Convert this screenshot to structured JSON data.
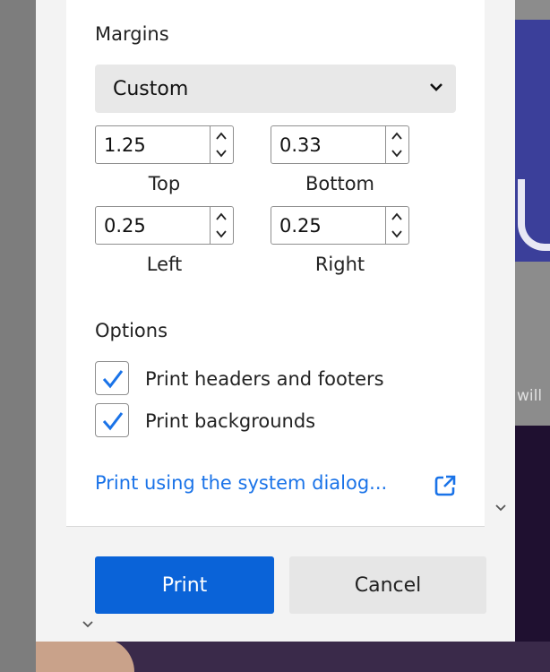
{
  "margins": {
    "heading": "Margins",
    "select_value": "Custom",
    "fields": {
      "top": {
        "value": "1.25",
        "label": "Top"
      },
      "bottom": {
        "value": "0.33",
        "label": "Bottom"
      },
      "left": {
        "value": "0.25",
        "label": "Left"
      },
      "right": {
        "value": "0.25",
        "label": "Right"
      }
    }
  },
  "options": {
    "heading": "Options",
    "items": [
      {
        "label": "Print headers and footers",
        "checked": true
      },
      {
        "label": "Print backgrounds",
        "checked": true
      }
    ]
  },
  "system_dialog_link": "Print using the system dialog...",
  "buttons": {
    "print": "Print",
    "cancel": "Cancel"
  },
  "background_text": "will",
  "colors": {
    "accent": "#0a63d8",
    "link": "#1a73e8",
    "check": "#1a73e8"
  },
  "icons": [
    "chevron-down-icon",
    "spin-up-icon",
    "spin-down-icon",
    "checkmark-icon",
    "open-external-icon"
  ]
}
